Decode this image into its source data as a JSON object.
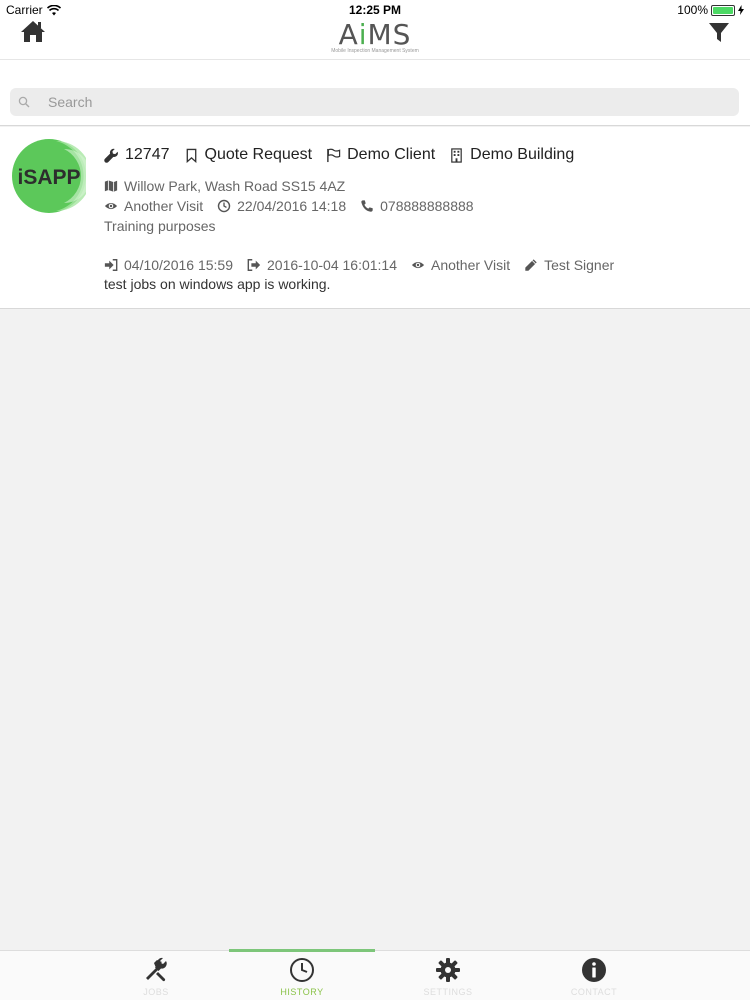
{
  "status": {
    "carrier": "Carrier",
    "time": "12:25 PM",
    "battery": "100%"
  },
  "header": {
    "logo_a": "A",
    "logo_i": "i",
    "logo_ms": "MS",
    "logo_sub": "Mobile Inspection Management System"
  },
  "search": {
    "placeholder": "Search",
    "value": ""
  },
  "job": {
    "avatar_text": "iSAPP",
    "id": "12747",
    "type": "Quote Request",
    "client": "Demo Client",
    "building": "Demo Building",
    "address": "Willow Park, Wash Road SS15 4AZ",
    "visit_type": "Another Visit",
    "scheduled": "22/04/2016 14:18",
    "phone": "078888888888",
    "notes": "Training purposes",
    "checkin": "04/10/2016 15:59",
    "checkout": "2016-10-04 16:01:14",
    "history_visit_type": "Another Visit",
    "signer": "Test Signer",
    "comment": "test jobs on windows app is working."
  },
  "tabs": [
    {
      "label": "JOBS",
      "icon": "tools-icon",
      "active": false
    },
    {
      "label": "HISTORY",
      "icon": "clock-icon",
      "active": true
    },
    {
      "label": "SETTINGS",
      "icon": "gear-icon",
      "active": false
    },
    {
      "label": "CONTACT",
      "icon": "info-icon",
      "active": false
    }
  ],
  "colors": {
    "accent": "#7dc67a",
    "avatar_green": "#5cc85a",
    "battery": "#4cd964"
  }
}
